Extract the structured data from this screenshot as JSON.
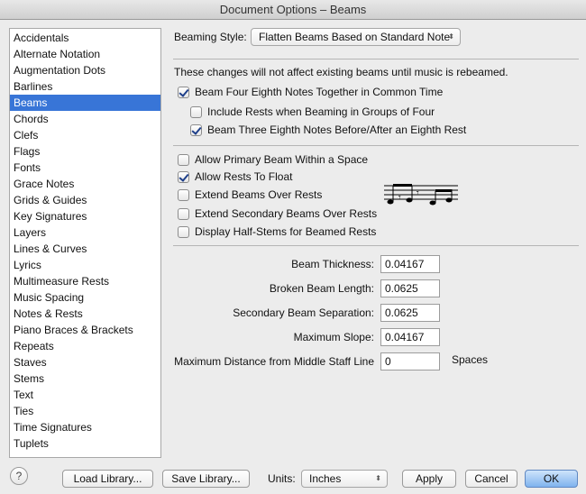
{
  "window": {
    "title": "Document Options – Beams"
  },
  "sidebar": {
    "items": [
      "Accidentals",
      "Alternate Notation",
      "Augmentation Dots",
      "Barlines",
      "Beams",
      "Chords",
      "Clefs",
      "Flags",
      "Fonts",
      "Grace Notes",
      "Grids & Guides",
      "Key Signatures",
      "Layers",
      "Lines & Curves",
      "Lyrics",
      "Multimeasure Rests",
      "Music Spacing",
      "Notes & Rests",
      "Piano Braces & Brackets",
      "Repeats",
      "Staves",
      "Stems",
      "Text",
      "Ties",
      "Time Signatures",
      "Tuplets"
    ],
    "selected": "Beams"
  },
  "beaming_style": {
    "label": "Beaming Style:",
    "value": "Flatten Beams Based on Standard Note"
  },
  "notice": "These changes will not affect existing beams until music is rebeamed.",
  "checkboxes": [
    {
      "label": "Beam Four Eighth Notes Together in Common Time",
      "checked": true
    },
    {
      "label": "Include Rests when Beaming in Groups of Four",
      "checked": false
    },
    {
      "label": "Beam Three Eighth Notes Before/After an Eighth Rest",
      "checked": true
    },
    {
      "label": "Allow Primary Beam Within a Space",
      "checked": false
    },
    {
      "label": "Allow Rests To Float",
      "checked": true
    },
    {
      "label": "Extend Beams Over Rests",
      "checked": false
    },
    {
      "label": "Extend Secondary Beams Over Rests",
      "checked": false
    },
    {
      "label": "Display Half-Stems for Beamed Rests",
      "checked": false
    }
  ],
  "fields": [
    {
      "label": "Beam Thickness:",
      "value": "0.04167"
    },
    {
      "label": "Broken Beam Length:",
      "value": "0.0625"
    },
    {
      "label": "Secondary Beam Separation:",
      "value": "0.0625"
    },
    {
      "label": "Maximum Slope:",
      "value": "0.04167"
    },
    {
      "label": "Maximum Distance from Middle Staff Line",
      "value": "0",
      "unit": "Spaces"
    }
  ],
  "footer": {
    "help": "?",
    "load": "Load Library...",
    "save": "Save Library...",
    "units_label": "Units:",
    "units_value": "Inches",
    "apply": "Apply",
    "cancel": "Cancel",
    "ok": "OK"
  }
}
